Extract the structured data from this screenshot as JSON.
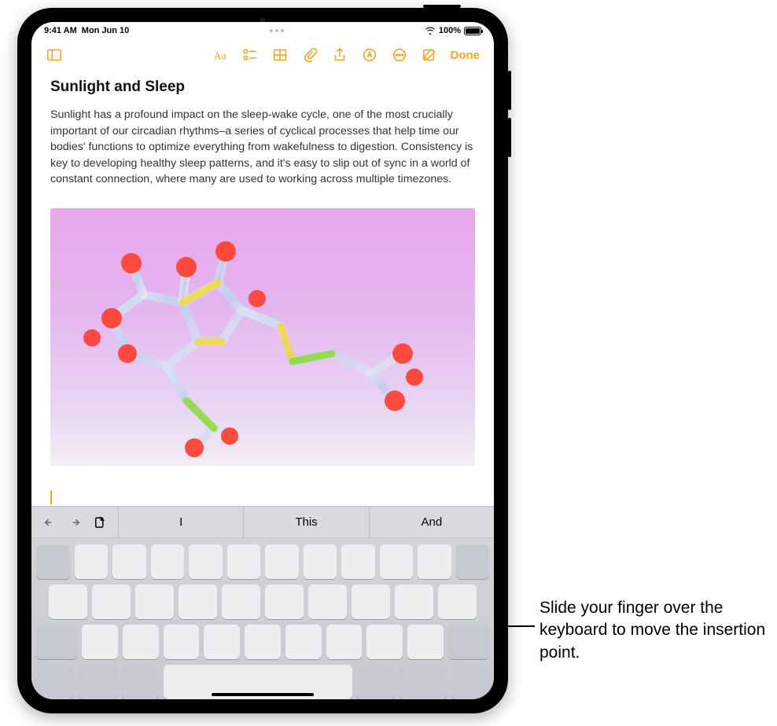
{
  "statusbar": {
    "time": "9:41 AM",
    "date": "Mon Jun 10",
    "battery_pct": "100%"
  },
  "toolbar": {
    "done_label": "Done"
  },
  "note": {
    "title": "Sunlight and Sleep",
    "body": "Sunlight has a profound impact on the sleep-wake cycle, one of the most crucially important of our circadian rhythms–a series of cyclical processes that help time our bodies' functions to optimize everything from wakefulness to digestion. Consistency is key to developing healthy sleep patterns, and it's easy to slip out of sync in a world of constant connection, where many are used to working across multiple timezones."
  },
  "keyboard": {
    "suggestions": [
      "I",
      "This",
      "And"
    ]
  },
  "callout": {
    "text": "Slide your finger over the keyboard to move the insertion point."
  }
}
